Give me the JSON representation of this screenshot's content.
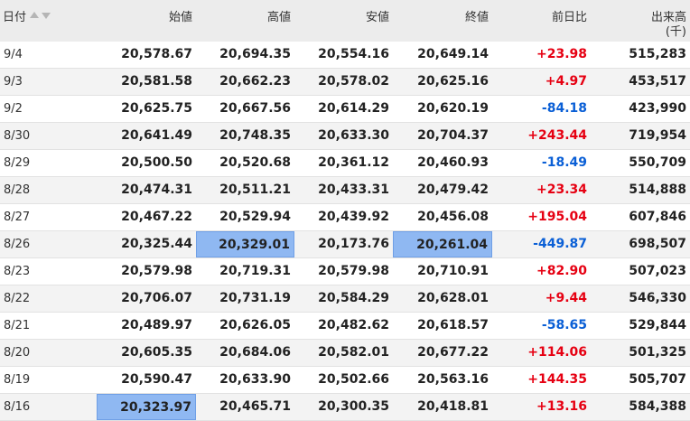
{
  "header": {
    "date": "日付",
    "open": "始値",
    "high": "高値",
    "low": "安値",
    "close": "終値",
    "change": "前日比",
    "volume": "出来高",
    "volume_unit": "(千)"
  },
  "colors": {
    "positive": "#e60012",
    "negative": "#0a5fd6",
    "highlight": "#8fb8f2"
  },
  "rows": [
    {
      "date": "9/4",
      "open": "20,578.67",
      "high": "20,694.35",
      "low": "20,554.16",
      "close": "20,649.14",
      "change": "+23.98",
      "volume": "515,283"
    },
    {
      "date": "9/3",
      "open": "20,581.58",
      "high": "20,662.23",
      "low": "20,578.02",
      "close": "20,625.16",
      "change": "+4.97",
      "volume": "453,517"
    },
    {
      "date": "9/2",
      "open": "20,625.75",
      "high": "20,667.56",
      "low": "20,614.29",
      "close": "20,620.19",
      "change": "-84.18",
      "volume": "423,990"
    },
    {
      "date": "8/30",
      "open": "20,641.49",
      "high": "20,748.35",
      "low": "20,633.30",
      "close": "20,704.37",
      "change": "+243.44",
      "volume": "719,954"
    },
    {
      "date": "8/29",
      "open": "20,500.50",
      "high": "20,520.68",
      "low": "20,361.12",
      "close": "20,460.93",
      "change": "-18.49",
      "volume": "550,709"
    },
    {
      "date": "8/28",
      "open": "20,474.31",
      "high": "20,511.21",
      "low": "20,433.31",
      "close": "20,479.42",
      "change": "+23.34",
      "volume": "514,888"
    },
    {
      "date": "8/27",
      "open": "20,467.22",
      "high": "20,529.94",
      "low": "20,439.92",
      "close": "20,456.08",
      "change": "+195.04",
      "volume": "607,846"
    },
    {
      "date": "8/26",
      "open": "20,325.44",
      "high": "20,329.01",
      "low": "20,173.76",
      "close": "20,261.04",
      "change": "-449.87",
      "volume": "698,507",
      "highlight": [
        "high",
        "close"
      ]
    },
    {
      "date": "8/23",
      "open": "20,579.98",
      "high": "20,719.31",
      "low": "20,579.98",
      "close": "20,710.91",
      "change": "+82.90",
      "volume": "507,023"
    },
    {
      "date": "8/22",
      "open": "20,706.07",
      "high": "20,731.19",
      "low": "20,584.29",
      "close": "20,628.01",
      "change": "+9.44",
      "volume": "546,330"
    },
    {
      "date": "8/21",
      "open": "20,489.97",
      "high": "20,626.05",
      "low": "20,482.62",
      "close": "20,618.57",
      "change": "-58.65",
      "volume": "529,844"
    },
    {
      "date": "8/20",
      "open": "20,605.35",
      "high": "20,684.06",
      "low": "20,582.01",
      "close": "20,677.22",
      "change": "+114.06",
      "volume": "501,325"
    },
    {
      "date": "8/19",
      "open": "20,590.47",
      "high": "20,633.90",
      "low": "20,502.66",
      "close": "20,563.16",
      "change": "+144.35",
      "volume": "505,707"
    },
    {
      "date": "8/16",
      "open": "20,323.97",
      "high": "20,465.71",
      "low": "20,300.35",
      "close": "20,418.81",
      "change": "+13.16",
      "volume": "584,388",
      "highlight": [
        "open"
      ]
    }
  ]
}
